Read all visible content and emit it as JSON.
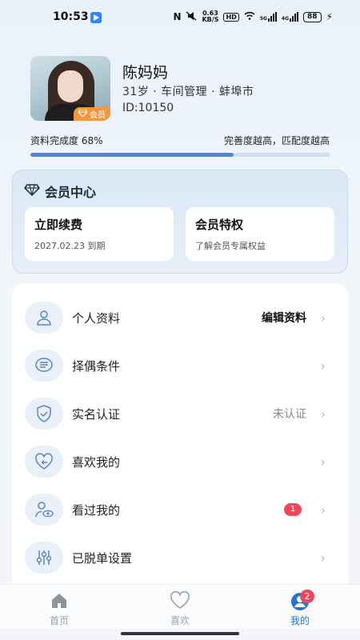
{
  "status_bar": {
    "time": "10:53",
    "nfc": "N",
    "speed_value": "0.63",
    "speed_unit": "KB/S",
    "hd": "HD",
    "net1": "5G",
    "net2": "4G",
    "battery": "88"
  },
  "profile": {
    "name": "陈妈妈",
    "info": "31岁 · 车间管理 · 蚌埠市",
    "id": "ID:10150",
    "vip_tag": "会员"
  },
  "completion": {
    "label": "资料完成度 68%",
    "hint": "完善度越高，匹配度越高",
    "percent": 68
  },
  "member_center": {
    "title": "会员中心",
    "cards": [
      {
        "title": "立即续费",
        "subtitle": "2027.02.23  到期"
      },
      {
        "title": "会员特权",
        "subtitle": "了解会员专属权益"
      }
    ]
  },
  "menu": {
    "items": [
      {
        "label": "个人资料",
        "value": "编辑资料",
        "icon": "person-icon"
      },
      {
        "label": "择偶条件",
        "value": "",
        "icon": "list-bubble-icon"
      },
      {
        "label": "实名认证",
        "value": "未认证",
        "icon": "shield-check-icon"
      },
      {
        "label": "喜欢我的",
        "value": "",
        "icon": "heart-arrow-icon"
      },
      {
        "label": "看过我的",
        "value": "",
        "badge": "1",
        "icon": "viewer-eye-icon"
      },
      {
        "label": "已脱单设置",
        "value": "",
        "icon": "sliders-icon"
      }
    ]
  },
  "bottom_nav": {
    "items": [
      {
        "label": "首页",
        "icon": "home-icon"
      },
      {
        "label": "喜欢",
        "icon": "heart-icon"
      },
      {
        "label": "我的",
        "icon": "profile-icon",
        "badge": "2"
      }
    ]
  },
  "colors": {
    "accent": "#2b6fd6",
    "progress": "#4f87d9",
    "badge": "#f0485a",
    "vip": "#f1983f"
  }
}
